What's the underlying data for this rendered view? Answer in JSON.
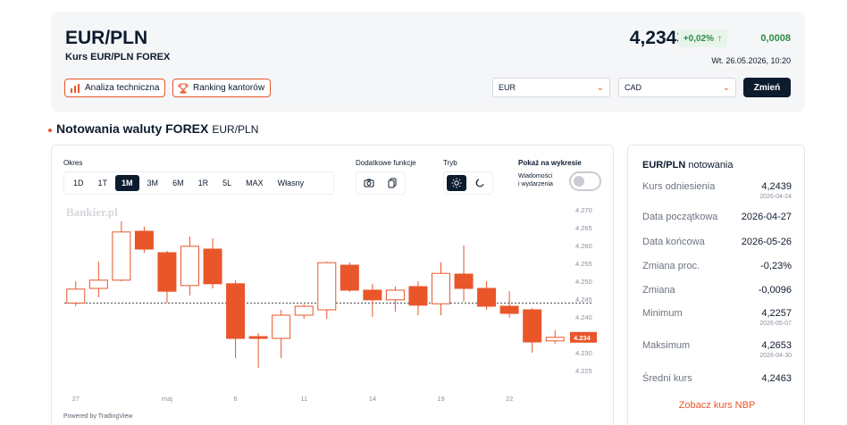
{
  "header": {
    "title": "EUR/PLN",
    "subtitle": "Kurs EUR/PLN FOREX",
    "price": "4,2343",
    "change_pct": "+0,02%",
    "change_arrow": "↑",
    "change_abs": "0,0008",
    "datetime": "Wt. 26.05.2026, 10:20",
    "btn_analysis": "Analiza techniczna",
    "btn_ranking": "Ranking kantorów",
    "select_from": "EUR",
    "select_to": "CAD",
    "btn_change": "Zmień"
  },
  "section": {
    "title": "Notowania waluty FOREX",
    "subtitle": "EUR/PLN"
  },
  "controls": {
    "period_label": "Okres",
    "periods": [
      "1D",
      "1T",
      "1M",
      "3M",
      "6M",
      "1R",
      "5L",
      "MAX",
      "Własny"
    ],
    "active_period": "1M",
    "extra_label": "Dodatkowe funkcje",
    "mode_label": "Tryb",
    "show_label": "Pokaż na wykresie",
    "show_sub1": "Wiadomości",
    "show_sub2": "i wydarzenia"
  },
  "chart_data": {
    "type": "candlestick",
    "watermark": "Bankier.pl",
    "x_ticks": [
      {
        "label": "27",
        "index": 0
      },
      {
        "label": "maj",
        "index": 4
      },
      {
        "label": "6",
        "index": 7
      },
      {
        "label": "11",
        "index": 10
      },
      {
        "label": "14",
        "index": 13
      },
      {
        "label": "19",
        "index": 16
      },
      {
        "label": "22",
        "index": 19
      }
    ],
    "y_ticks": [
      4.225,
      4.23,
      4.235,
      4.24,
      4.245,
      4.25,
      4.255,
      4.26,
      4.265,
      4.27
    ],
    "ylim": [
      4.222,
      4.271
    ],
    "last_price": 4.2343,
    "last_label": "4.234",
    "dashed_level": 4.2439,
    "candles": [
      {
        "o": 4.2439,
        "h": 4.25,
        "l": 4.243,
        "c": 4.2478
      },
      {
        "o": 4.248,
        "h": 4.2555,
        "l": 4.2455,
        "c": 4.2503
      },
      {
        "o": 4.2503,
        "h": 4.2668,
        "l": 4.25,
        "c": 4.2638
      },
      {
        "o": 4.264,
        "h": 4.2653,
        "l": 4.258,
        "c": 4.259
      },
      {
        "o": 4.258,
        "h": 4.2585,
        "l": 4.244,
        "c": 4.2472
      },
      {
        "o": 4.2488,
        "h": 4.2625,
        "l": 4.246,
        "c": 4.2598
      },
      {
        "o": 4.259,
        "h": 4.262,
        "l": 4.248,
        "c": 4.2493
      },
      {
        "o": 4.2493,
        "h": 4.2503,
        "l": 4.2285,
        "c": 4.234
      },
      {
        "o": 4.2345,
        "h": 4.2355,
        "l": 4.2257,
        "c": 4.234
      },
      {
        "o": 4.234,
        "h": 4.242,
        "l": 4.2285,
        "c": 4.2405
      },
      {
        "o": 4.2405,
        "h": 4.2435,
        "l": 4.2395,
        "c": 4.243
      },
      {
        "o": 4.242,
        "h": 4.2555,
        "l": 4.2395,
        "c": 4.2552
      },
      {
        "o": 4.2545,
        "h": 4.2553,
        "l": 4.247,
        "c": 4.2475
      },
      {
        "o": 4.2475,
        "h": 4.2493,
        "l": 4.24,
        "c": 4.2448
      },
      {
        "o": 4.2448,
        "h": 4.2485,
        "l": 4.2415,
        "c": 4.2475
      },
      {
        "o": 4.2485,
        "h": 4.25,
        "l": 4.2405,
        "c": 4.2433
      },
      {
        "o": 4.2437,
        "h": 4.2553,
        "l": 4.2405,
        "c": 4.2522
      },
      {
        "o": 4.252,
        "h": 4.26,
        "l": 4.2443,
        "c": 4.248
      },
      {
        "o": 4.248,
        "h": 4.25,
        "l": 4.242,
        "c": 4.243
      },
      {
        "o": 4.243,
        "h": 4.2472,
        "l": 4.2398,
        "c": 4.241
      },
      {
        "o": 4.242,
        "h": 4.2425,
        "l": 4.23,
        "c": 4.233
      },
      {
        "o": 4.2333,
        "h": 4.2363,
        "l": 4.2325,
        "c": 4.2343
      }
    ],
    "powered_by": "Powered by TradingView",
    "colors": {
      "candle": "#e8562a",
      "dashed": "#444444",
      "axis_text": "#8a919c"
    }
  },
  "stats": {
    "title_bold": "EUR/PLN",
    "title_rest": "notowania",
    "rows": [
      {
        "label": "Kurs odniesienia",
        "value": "4,2439",
        "date": "2026-04-24"
      },
      {
        "label": "Data początkowa",
        "value": "2026-04-27",
        "date": ""
      },
      {
        "label": "Data końcowa",
        "value": "2026-05-26",
        "date": ""
      },
      {
        "label": "Zmiana proc.",
        "value": "-0,23%",
        "date": ""
      },
      {
        "label": "Zmiana",
        "value": "-0,0096",
        "date": ""
      },
      {
        "label": "Minimum",
        "value": "4,2257",
        "date": "2026-05-07"
      },
      {
        "label": "Maksimum",
        "value": "4,2653",
        "date": "2026-04-30"
      },
      {
        "label": "Średni kurs",
        "value": "4,2463",
        "date": ""
      }
    ],
    "link_nbp": "Zobacz kurs NBP"
  },
  "colors": {
    "accent": "#e8562a",
    "navy": "#0d1b2e",
    "positive": "#2e8b47"
  }
}
